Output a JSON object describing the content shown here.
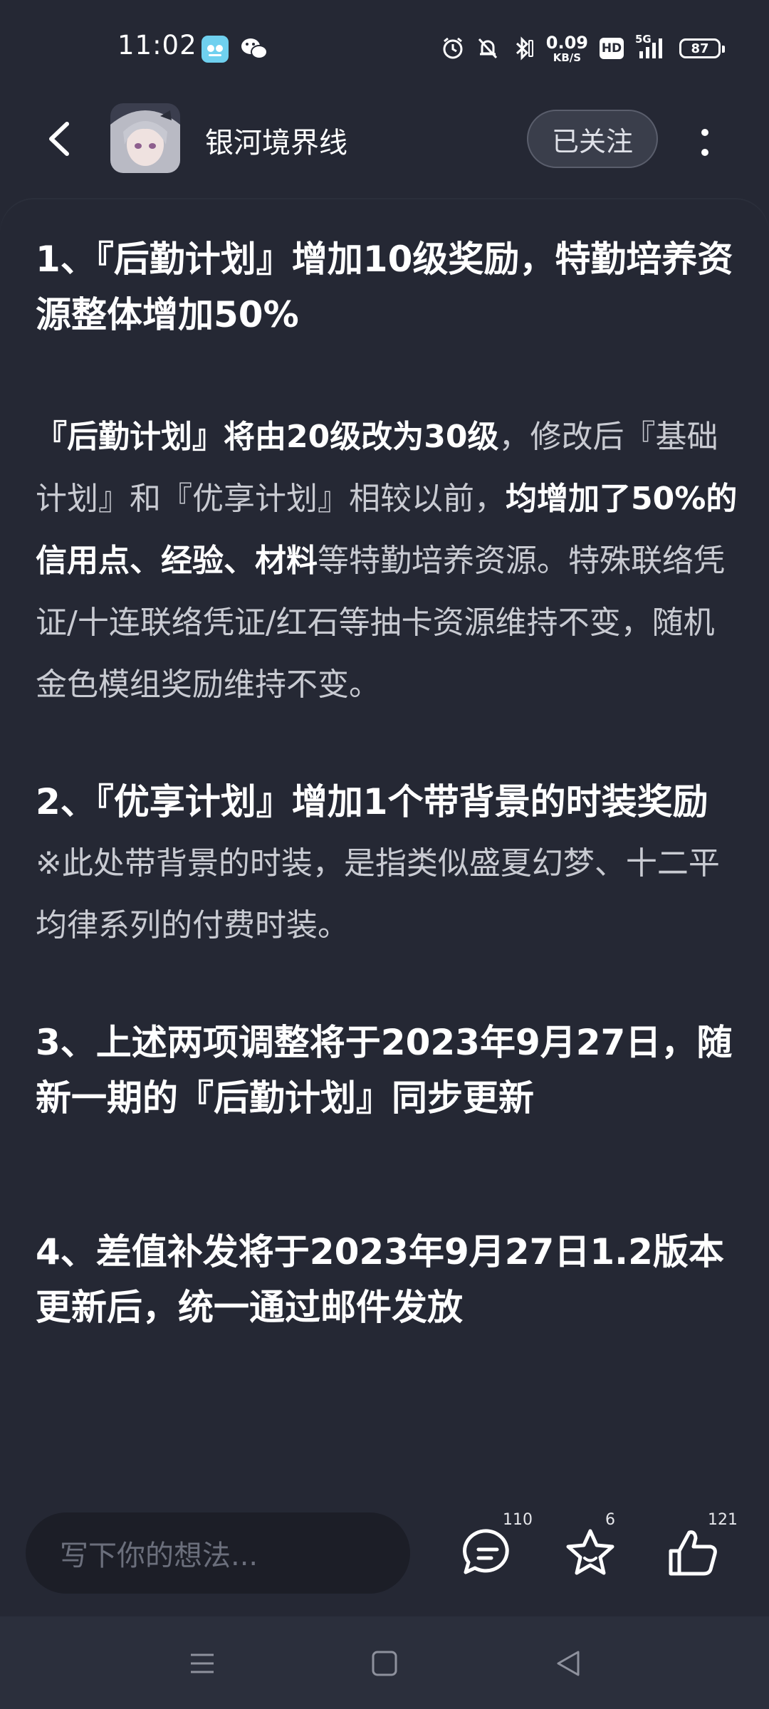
{
  "status_bar": {
    "time": "11:02",
    "net_speed_value": "0.09",
    "net_speed_unit": "KB/S",
    "hd_label": "HD",
    "signal_label": "5G",
    "battery": "87"
  },
  "header": {
    "account_name": "银河境界线",
    "follow_label": "已关注"
  },
  "article": {
    "heading1": "1、『后勤计划』增加10级奖励，特勤培养资源整体增加50%",
    "p1_bold1": "『后勤计划』将由20级改为30级",
    "p1_text1": "，修改后『基础计划』和『优享计划』相较以前，",
    "p1_bold2": "均增加了50%的信用点、经验、材料",
    "p1_text2": "等特勤培养资源。特殊联络凭证/十连联络凭证/红石等抽卡资源维持不变，随机金色模组奖励维持不变。",
    "heading2": "2、『优享计划』增加1个带背景的时装奖励",
    "p2": "※此处带背景的时装，是指类似盛夏幻梦、十二平均律系列的付费时装。",
    "heading3": "3、上述两项调整将于2023年9月27日，随新一期的『后勤计划』同步更新",
    "heading4": "4、差值补发将于2023年9月27日1.2版本更新后，统一通过邮件发放"
  },
  "bottom_bar": {
    "comment_placeholder": "写下你的想法...",
    "comment_count": "110",
    "favorite_count": "6",
    "like_count": "121"
  },
  "icons": {
    "back": "back-arrow-icon",
    "more": "more-vertical-icon",
    "comment": "comment-icon",
    "favorite": "star-icon",
    "like": "thumbs-up-icon",
    "nav_menu": "menu-icon",
    "nav_home": "home-square-icon",
    "nav_back": "back-triangle-icon"
  }
}
